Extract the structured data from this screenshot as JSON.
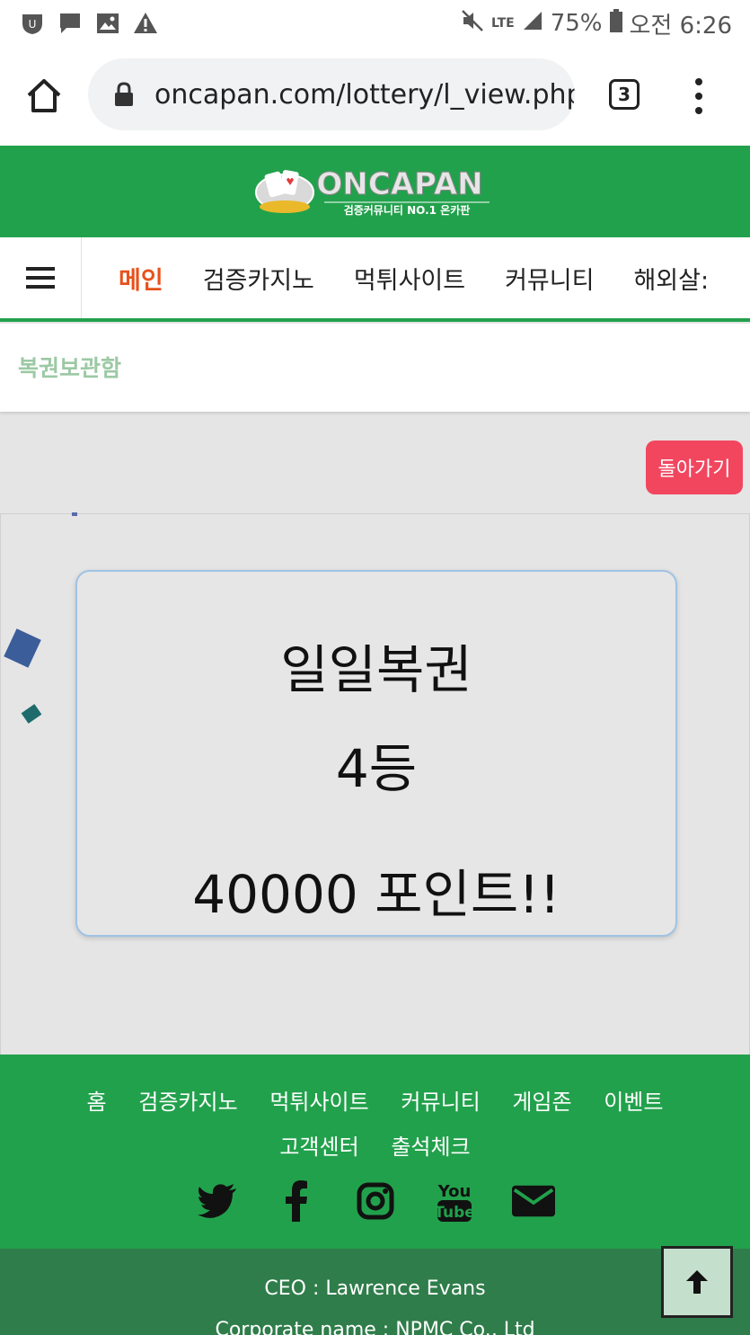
{
  "status_bar": {
    "icons_left": [
      "shield-app-icon",
      "chat-icon",
      "image-icon",
      "warning-icon"
    ],
    "mute_icon": "mute-icon",
    "network": "LTE",
    "battery": "75%",
    "time": "오전 6:26"
  },
  "browser": {
    "url": "oncapan.com/lottery/l_view.php",
    "tab_count": "3"
  },
  "site": {
    "logo_text": "ONCAPAN",
    "logo_subtext": "검증커뮤니티 NO.1 온카판",
    "brand_color": "#22a14c"
  },
  "nav": {
    "items": [
      "메인",
      "검증카지노",
      "먹튀사이트",
      "커뮤니티",
      "해외살:"
    ]
  },
  "page": {
    "title": "복권보관함",
    "back_label": "돌아가기"
  },
  "ticket": {
    "title": "일일복권",
    "rank": "4등",
    "points": "40000 포인트!!"
  },
  "footer": {
    "links": [
      "홈",
      "검증카지노",
      "먹튀사이트",
      "커뮤니티",
      "게임존",
      "이벤트",
      "고객센터",
      "출석체크"
    ],
    "social": [
      "twitter-icon",
      "facebook-icon",
      "instagram-icon",
      "youtube-icon",
      "email-icon"
    ],
    "ceo": "CEO : Lawrence Evans",
    "corporate": "Corporate name : NPMC Co., Ltd"
  }
}
